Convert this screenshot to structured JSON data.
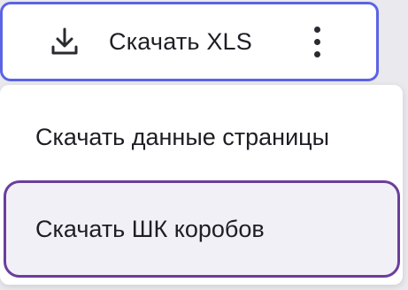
{
  "toolbar": {
    "download_label": "Скачать XLS",
    "download_icon": "download-icon",
    "more_icon": "more-vertical-icon"
  },
  "menu": {
    "items": [
      {
        "label": "Скачать данные страницы",
        "highlighted": false
      },
      {
        "label": "Скачать ШК коробов",
        "highlighted": true
      }
    ]
  },
  "colors": {
    "button_border": "#5b63e6",
    "highlight_border": "#6a3e9c",
    "highlight_bg": "#f1f0f6",
    "text": "#1e1e24"
  }
}
